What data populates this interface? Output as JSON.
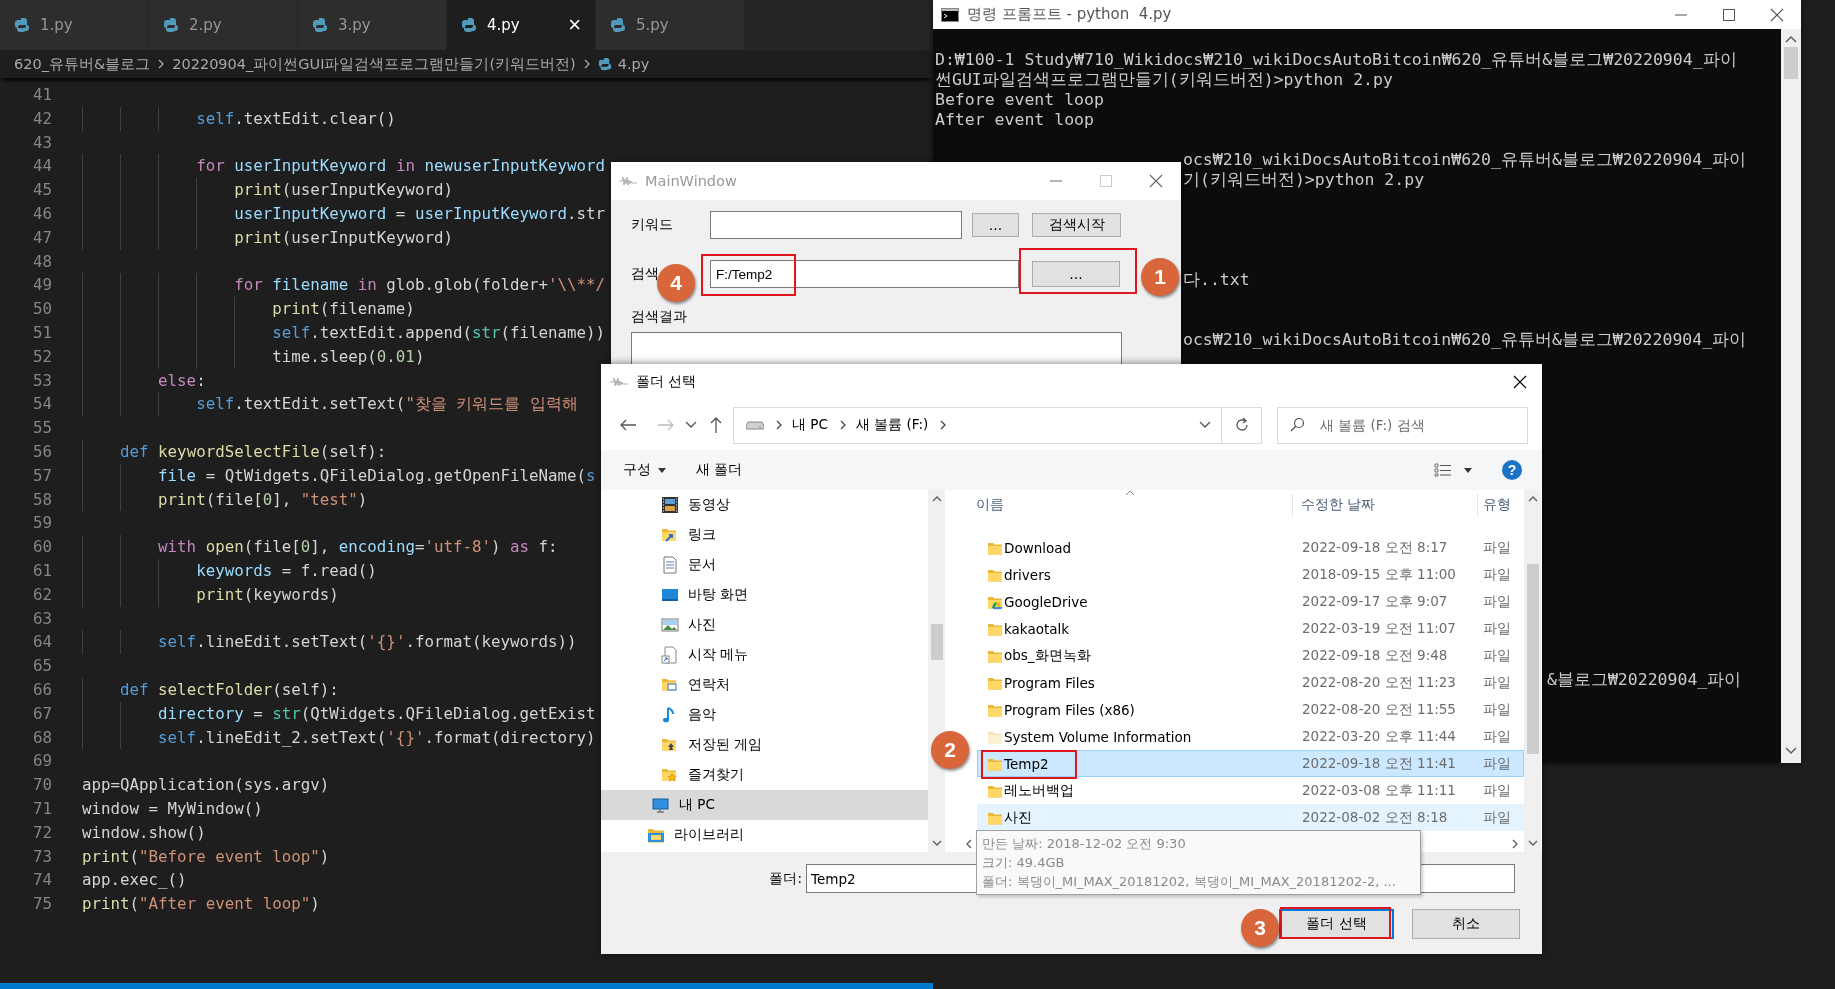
{
  "editor": {
    "tabs": [
      {
        "label": "1.py",
        "selected": false
      },
      {
        "label": "2.py",
        "selected": false
      },
      {
        "label": "3.py",
        "selected": false
      },
      {
        "label": "4.py",
        "selected": true,
        "close": "×"
      },
      {
        "label": "5.py",
        "selected": false
      }
    ],
    "breadcrumb": [
      "620_유튜버&블로그",
      "20220904_파이썬GUI파일검색프로그램만들기(키워드버전)",
      "4.py"
    ],
    "lines": [
      {
        "number": "41"
      },
      {
        "number": "42",
        "segments": [
          {
            "text": "            self",
            "kind": "keyword"
          },
          {
            "text": ".textEdit.clear()",
            "kind": "plain"
          }
        ]
      },
      {
        "number": "43"
      },
      {
        "number": "44",
        "segments": [
          {
            "text": "            for",
            "kind": "control"
          },
          {
            "text": " userInputKeyword ",
            "kind": "variable"
          },
          {
            "text": "in",
            "kind": "control"
          },
          {
            "text": " newuserInputKeyword",
            "kind": "variable"
          }
        ]
      },
      {
        "number": "45",
        "segments": [
          {
            "text": "                print",
            "kind": "function"
          },
          {
            "text": "(userInputKeyword)",
            "kind": "plain"
          }
        ]
      },
      {
        "number": "46",
        "segments": [
          {
            "text": "                userInputKeyword",
            "kind": "variable"
          },
          {
            "text": " = ",
            "kind": "plain"
          },
          {
            "text": "userInputKeyword",
            "kind": "variable"
          },
          {
            "text": ".str",
            "kind": "plain"
          }
        ]
      },
      {
        "number": "47",
        "segments": [
          {
            "text": "                print",
            "kind": "function"
          },
          {
            "text": "(userInputKeyword)",
            "kind": "plain"
          }
        ]
      },
      {
        "number": "48"
      },
      {
        "number": "49",
        "segments": [
          {
            "text": "                for",
            "kind": "control"
          },
          {
            "text": " filename ",
            "kind": "variable"
          },
          {
            "text": "in",
            "kind": "control"
          },
          {
            "text": " glob.glob(folder+",
            "kind": "plain"
          },
          {
            "text": "'\\\\**/",
            "kind": "string"
          }
        ]
      },
      {
        "number": "50",
        "segments": [
          {
            "text": "                    print",
            "kind": "function"
          },
          {
            "text": "(filename)",
            "kind": "plain"
          }
        ]
      },
      {
        "number": "51",
        "segments": [
          {
            "text": "                    self",
            "kind": "keyword"
          },
          {
            "text": ".textEdit.append(",
            "kind": "plain"
          },
          {
            "text": "str",
            "kind": "type"
          },
          {
            "text": "(filename))",
            "kind": "plain"
          }
        ]
      },
      {
        "number": "52",
        "segments": [
          {
            "text": "                    time.sleep(",
            "kind": "plain"
          },
          {
            "text": "0.01",
            "kind": "number"
          },
          {
            "text": ")",
            "kind": "plain"
          }
        ]
      },
      {
        "number": "53",
        "segments": [
          {
            "text": "        else",
            "kind": "control"
          },
          {
            "text": ":",
            "kind": "plain"
          }
        ]
      },
      {
        "number": "54",
        "segments": [
          {
            "text": "            self",
            "kind": "keyword"
          },
          {
            "text": ".textEdit.setText(",
            "kind": "plain"
          },
          {
            "text": "\"찾을 키워드를 입력해",
            "kind": "string"
          }
        ]
      },
      {
        "number": "55"
      },
      {
        "number": "56",
        "segments": [
          {
            "text": "    def ",
            "kind": "keyword"
          },
          {
            "text": "keywordSelectFile",
            "kind": "function"
          },
          {
            "text": "(self):",
            "kind": "plain"
          }
        ]
      },
      {
        "number": "57",
        "segments": [
          {
            "text": "        file",
            "kind": "variable"
          },
          {
            "text": " = QtWidgets.QFileDialog.getOpenFileName(",
            "kind": "plain"
          },
          {
            "text": "s",
            "kind": "keyword"
          }
        ]
      },
      {
        "number": "58",
        "segments": [
          {
            "text": "        print",
            "kind": "function"
          },
          {
            "text": "(file[",
            "kind": "plain"
          },
          {
            "text": "0",
            "kind": "number"
          },
          {
            "text": "], ",
            "kind": "plain"
          },
          {
            "text": "\"test\"",
            "kind": "string"
          },
          {
            "text": ")",
            "kind": "plain"
          }
        ]
      },
      {
        "number": "59"
      },
      {
        "number": "60",
        "segments": [
          {
            "text": "        with ",
            "kind": "control"
          },
          {
            "text": "open",
            "kind": "function"
          },
          {
            "text": "(file[",
            "kind": "plain"
          },
          {
            "text": "0",
            "kind": "number"
          },
          {
            "text": "], ",
            "kind": "plain"
          },
          {
            "text": "encoding",
            "kind": "variable"
          },
          {
            "text": "=",
            "kind": "plain"
          },
          {
            "text": "'utf-8'",
            "kind": "string"
          },
          {
            "text": ") ",
            "kind": "plain"
          },
          {
            "text": "as",
            "kind": "control"
          },
          {
            "text": " f:",
            "kind": "plain"
          }
        ]
      },
      {
        "number": "61",
        "segments": [
          {
            "text": "            keywords",
            "kind": "variable"
          },
          {
            "text": " = f.read()",
            "kind": "plain"
          }
        ]
      },
      {
        "number": "62",
        "segments": [
          {
            "text": "            print",
            "kind": "function"
          },
          {
            "text": "(keywords)",
            "kind": "plain"
          }
        ]
      },
      {
        "number": "63"
      },
      {
        "number": "64",
        "segments": [
          {
            "text": "        self",
            "kind": "keyword"
          },
          {
            "text": ".lineEdit.setText(",
            "kind": "plain"
          },
          {
            "text": "'{}'",
            "kind": "string"
          },
          {
            "text": ".format(keywords))",
            "kind": "plain"
          }
        ]
      },
      {
        "number": "65"
      },
      {
        "number": "66",
        "segments": [
          {
            "text": "    def ",
            "kind": "keyword"
          },
          {
            "text": "selectFolder",
            "kind": "function"
          },
          {
            "text": "(self):",
            "kind": "plain"
          }
        ]
      },
      {
        "number": "67",
        "segments": [
          {
            "text": "        directory",
            "kind": "variable"
          },
          {
            "text": " = ",
            "kind": "plain"
          },
          {
            "text": "str",
            "kind": "type"
          },
          {
            "text": "(QtWidgets.QFileDialog.getExist",
            "kind": "plain"
          }
        ]
      },
      {
        "number": "68",
        "segments": [
          {
            "text": "        self",
            "kind": "keyword"
          },
          {
            "text": ".lineEdit_2.setText(",
            "kind": "plain"
          },
          {
            "text": "'{}'",
            "kind": "string"
          },
          {
            "text": ".format(directory)",
            "kind": "plain"
          }
        ]
      },
      {
        "number": "69"
      },
      {
        "number": "70",
        "segments": [
          {
            "text": "app=QApplication(sys.argv)",
            "kind": "plain"
          }
        ]
      },
      {
        "number": "71",
        "segments": [
          {
            "text": "window = MyWindow()",
            "kind": "plain"
          }
        ]
      },
      {
        "number": "72",
        "segments": [
          {
            "text": "window.show()",
            "kind": "plain"
          }
        ]
      },
      {
        "number": "73",
        "segments": [
          {
            "text": "print",
            "kind": "function"
          },
          {
            "text": "(",
            "kind": "plain"
          },
          {
            "text": "\"Before event loop\"",
            "kind": "string"
          },
          {
            "text": ")",
            "kind": "plain"
          }
        ]
      },
      {
        "number": "74",
        "segments": [
          {
            "text": "app.exec_()",
            "kind": "plain"
          }
        ]
      },
      {
        "number": "75",
        "segments": [
          {
            "text": "print",
            "kind": "function"
          },
          {
            "text": "(",
            "kind": "plain"
          },
          {
            "text": "\"After event loop\"",
            "kind": "string"
          },
          {
            "text": ")",
            "kind": "plain"
          }
        ]
      }
    ]
  },
  "cmd_window": {
    "title": "명령 프롬프트 - python  4.py",
    "lines": [
      {
        "text": "D:₩100-1 Study₩710_Wikidocs₩210_wikiDocsAutoBitcoin₩620_유튜버&블로그₩20220904_파이",
        "kind": "full"
      },
      {
        "text": "썬GUI파일검색프로그램만들기(키워드버전)>python 2.py",
        "kind": "full"
      },
      {
        "text": "Before event loop",
        "kind": "full"
      },
      {
        "text": "After event loop",
        "kind": "full"
      },
      {
        "kind": "blank"
      },
      {
        "text": "ocs₩210_wikiDocsAutoBitcoin₩620_유튜버&블로그₩20220904_파이",
        "kind": "after-main-window"
      },
      {
        "text": "기(키워드버전)>python 2.py",
        "kind": "after-main-window"
      },
      {
        "kind": "blank"
      },
      {
        "kind": "blank"
      },
      {
        "kind": "blank"
      },
      {
        "kind": "blank"
      },
      {
        "text": "다..txt",
        "kind": "after-main-window"
      },
      {
        "kind": "blank"
      },
      {
        "kind": "blank"
      },
      {
        "text": "ocs₩210_wikiDocsAutoBitcoin₩620_유튜버&블로그₩20220904_파이",
        "kind": "after-main-window"
      },
      {
        "kind": "blank"
      },
      {
        "kind": "blank"
      },
      {
        "kind": "blank"
      },
      {
        "kind": "blank"
      },
      {
        "kind": "blank"
      },
      {
        "kind": "blank"
      },
      {
        "kind": "blank"
      },
      {
        "kind": "blank"
      },
      {
        "kind": "blank"
      },
      {
        "kind": "blank"
      },
      {
        "kind": "blank"
      },
      {
        "kind": "blank"
      },
      {
        "kind": "blank"
      },
      {
        "kind": "blank"
      },
      {
        "kind": "blank"
      },
      {
        "kind": "blank"
      },
      {
        "text": "&블로그₩20220904_파이",
        "kind": "after-folder-dialog"
      }
    ]
  },
  "main_window": {
    "title": "MainWindow",
    "keyword_label": "키워드",
    "keyword_browse": "...",
    "search_button": "검색시작",
    "folder_label": "검색",
    "folder_value": "F:/Temp2",
    "folder_callout": "4",
    "folder_browse": "...",
    "browse_callout": "1",
    "results_label": "검색결과"
  },
  "folder_dialog": {
    "title": "폴더 선택",
    "address": [
      "내 PC",
      "새 볼륨 (F:)"
    ],
    "search": {
      "placeholder": "새 볼륨 (F:) 검색"
    },
    "toolbar": {
      "organize": "구성",
      "new_folder": "새 폴더",
      "help": "?"
    },
    "nav_pane": {
      "nested_items": [
        {
          "label": "동영상",
          "kind": "video",
          "selected": false
        },
        {
          "label": "링크",
          "kind": "link",
          "selected": false
        },
        {
          "label": "문서",
          "kind": "document",
          "selected": false
        },
        {
          "label": "바탕 화면",
          "kind": "desktop",
          "selected": false
        },
        {
          "label": "사진",
          "kind": "pictures",
          "selected": false
        },
        {
          "label": "시작 메뉴",
          "kind": "start-menu",
          "selected": false
        },
        {
          "label": "연락처",
          "kind": "contacts",
          "selected": false
        },
        {
          "label": "음악",
          "kind": "music",
          "selected": false
        },
        {
          "label": "저장된 게임",
          "kind": "saved-games",
          "selected": false
        },
        {
          "label": "즐겨찾기",
          "kind": "favorites",
          "selected": false
        }
      ],
      "top_items": [
        {
          "label": "내 PC",
          "kind": "pc",
          "selected": true
        },
        {
          "label": "라이브러리",
          "kind": "library",
          "selected": false
        }
      ]
    },
    "columns": [
      "이름",
      "수정한 날짜",
      "유형"
    ],
    "files": [
      {
        "name": "Download",
        "modified": "2022-09-18 오전 8:17",
        "type": "파일",
        "kind": "folder",
        "selected": false,
        "hovered": false
      },
      {
        "name": "drivers",
        "modified": "2018-09-15 오후 11:00",
        "type": "파일",
        "kind": "folder",
        "selected": false,
        "hovered": false
      },
      {
        "name": "GoogleDrive",
        "modified": "2022-09-17 오후 9:07",
        "type": "파일",
        "kind": "drive-folder",
        "selected": false,
        "hovered": false
      },
      {
        "name": "kakaotalk",
        "modified": "2022-03-19 오전 11:07",
        "type": "파일",
        "kind": "folder",
        "selected": false,
        "hovered": false
      },
      {
        "name": "obs_화면녹화",
        "modified": "2022-09-18 오전 9:48",
        "type": "파일",
        "kind": "folder",
        "selected": false,
        "hovered": false
      },
      {
        "name": "Program Files",
        "modified": "2022-08-20 오전 11:23",
        "type": "파일",
        "kind": "folder",
        "selected": false,
        "hovered": false
      },
      {
        "name": "Program Files (x86)",
        "modified": "2022-08-20 오전 11:55",
        "type": "파일",
        "kind": "folder",
        "selected": false,
        "hovered": false
      },
      {
        "name": "System Volume Information",
        "modified": "2022-03-20 오후 11:44",
        "type": "파일",
        "kind": "system-folder",
        "selected": false,
        "hovered": false
      },
      {
        "name": "Temp2",
        "modified": "2022-09-18 오전 11:41",
        "type": "파일",
        "kind": "folder",
        "selected": true,
        "hovered": false,
        "callout": "2"
      },
      {
        "name": "레노버백업",
        "modified": "2022-03-08 오후 11:11",
        "type": "파일",
        "kind": "folder",
        "selected": false,
        "hovered": false
      },
      {
        "name": "사진",
        "modified": "2022-08-02 오전 8:18",
        "type": "파일",
        "kind": "folder",
        "selected": false,
        "hovered": true
      }
    ],
    "tooltip": [
      "만든 날짜: 2018-12-02 오전 9:30",
      "크기: 49.4GB",
      "폴더: 복댕이_MI_MAX_20181202, 복댕이_MI_MAX_20181202-2, ..."
    ],
    "folder_label": "폴더:",
    "folder_value": "Temp2",
    "select_button": "폴더 선택",
    "select_callout": "3",
    "cancel_button": "취소"
  }
}
